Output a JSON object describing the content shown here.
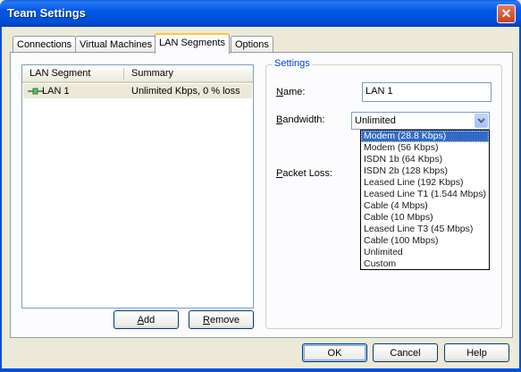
{
  "window": {
    "title": "Team Settings",
    "close_glyph": "✕"
  },
  "tabs": [
    {
      "label": "Connections"
    },
    {
      "label": "Virtual Machines"
    },
    {
      "label": "LAN Segments"
    },
    {
      "label": "Options"
    }
  ],
  "lan_list": {
    "columns": [
      "LAN Segment",
      "Summary"
    ],
    "rows": [
      {
        "icon": "network-link-icon",
        "name": "LAN 1",
        "summary": "Unlimited Kbps, 0 % loss"
      }
    ]
  },
  "list_buttons": {
    "add_access": "A",
    "add_rest": "dd",
    "remove_access": "R",
    "remove_rest": "emove"
  },
  "settings": {
    "group_label": "Settings",
    "name_access": "N",
    "name_rest": "ame:",
    "name_value": "LAN 1",
    "bandwidth_access": "B",
    "bandwidth_rest": "andwidth:",
    "bandwidth_value": "Unlimited",
    "packet_loss_access": "P",
    "packet_loss_rest": "acket Loss:",
    "bandwidth_options": [
      "Modem (28.8 Kbps)",
      "Modem (56 Kbps)",
      "ISDN 1b (64 Kbps)",
      "ISDN 2b (128 Kbps)",
      "Leased Line (192 Kbps)",
      "Leased Line T1 (1.544 Mbps)",
      "Cable (4 Mbps)",
      "Cable (10 Mbps)",
      "Leased Line T3 (45 Mbps)",
      "Cable (100 Mbps)",
      "Unlimited",
      "Custom"
    ],
    "highlighted_option_index": 0
  },
  "dialog_buttons": {
    "ok": "OK",
    "cancel": "Cancel",
    "help": "Help"
  },
  "colors": {
    "title_bar": "#0054e3",
    "selection": "#316ac5",
    "tab_active_accent": "#ffc83c"
  }
}
